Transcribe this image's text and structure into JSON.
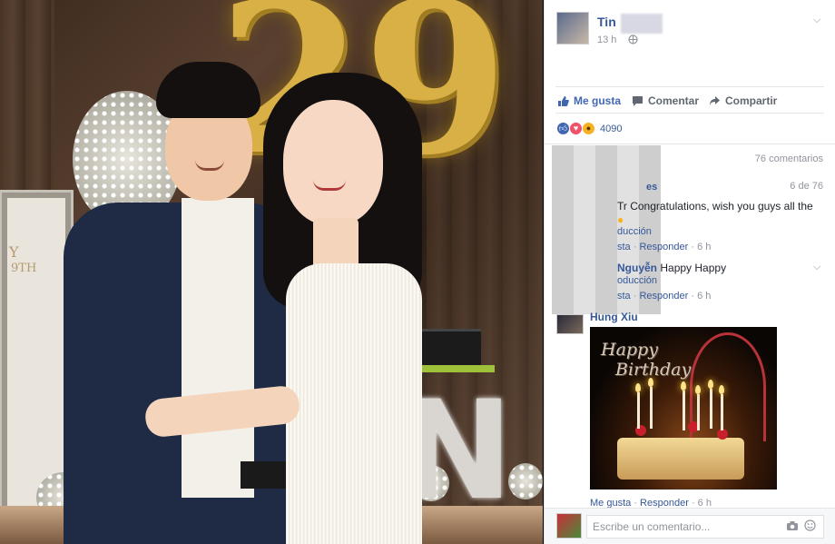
{
  "post": {
    "author": "Tin",
    "time": "13 h",
    "audience_icon": "globe-icon"
  },
  "actions": {
    "like": "Me gusta",
    "comment": "Comentar",
    "share": "Compartir"
  },
  "reactions": {
    "count": "4090",
    "types": [
      "like-icon",
      "love-icon",
      "wow-icon"
    ]
  },
  "comments_summary": {
    "count_label": "76 comentarios",
    "page_label": "6 de 76"
  },
  "comments": [
    {
      "name_partial": "es",
      "text": "Tr Congratulations, wish you guys all the",
      "translate": "ducción",
      "like": "sta",
      "reply": "Responder",
      "time": "6 h"
    },
    {
      "name_partial": "Nguyễn",
      "text": "Happy Happy",
      "translate": "oducción",
      "like": "sta",
      "reply": "Responder",
      "time": "6 h"
    },
    {
      "name_partial": "Hung Xiu",
      "image_text": [
        "Happy",
        "Birthday"
      ],
      "like": "Me gusta",
      "reply": "Responder",
      "time": "6 h"
    }
  ],
  "composer": {
    "placeholder": "Escribe un comentario...",
    "camera_icon": "camera-icon",
    "emoji_icon": "emoji-icon"
  },
  "photo": {
    "balloon_digits": "29",
    "frame_text": [
      "Y",
      "9TH"
    ],
    "letter": "N"
  },
  "colors": {
    "link": "#365899",
    "like_blue": "#4267b2",
    "love_red": "#f25268",
    "wow_yellow": "#f7b125"
  }
}
